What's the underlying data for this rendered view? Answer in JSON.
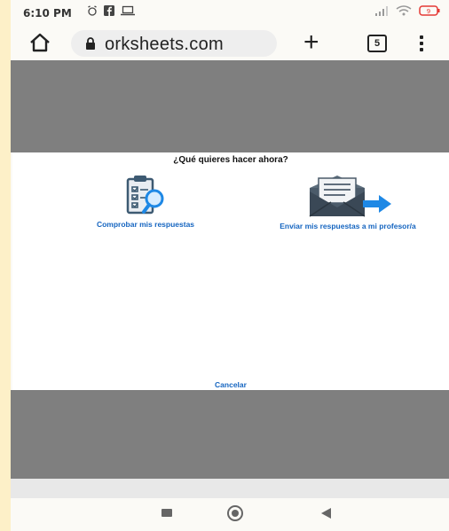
{
  "status_bar": {
    "time": "6:10 PM"
  },
  "browser": {
    "url": "orksheets.com",
    "tab_count": "5"
  },
  "dialog": {
    "title": "¿Qué quieres hacer ahora?",
    "option_check_label": "Comprobar mis respuestas",
    "option_send_label": "Enviar mis respuestas a mi profesor/a",
    "cancel_label": "Cancelar"
  },
  "colors": {
    "accent": "#1565c0",
    "overlay_gray": "#7f7f7f",
    "frame": "#fdf0c8"
  }
}
